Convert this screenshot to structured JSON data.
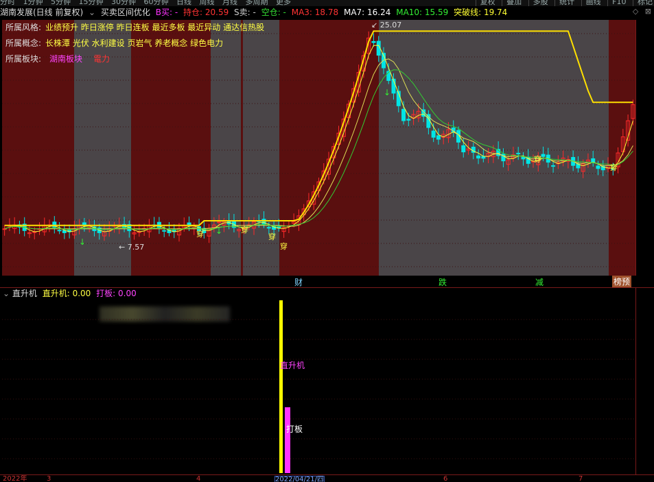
{
  "topbar": {
    "items": [
      "分时",
      "1分钟",
      "5分钟",
      "15分钟",
      "30分钟",
      "60分钟",
      "日线",
      "周线",
      "月线",
      "多周期",
      "更多"
    ],
    "right_items": [
      "复权",
      "叠加",
      "多股",
      "统计",
      "画线",
      "F10",
      "标记"
    ]
  },
  "title": {
    "stock": "湖南发展(日线 前复权)",
    "indicator": "买卖区间优化",
    "b_label": "B买: -",
    "hold_label": "持仓: 20.59",
    "s_label": "S卖: -",
    "empty_label": "空仓: -",
    "ma3": "MA3: 18.78",
    "ma7": "MA7: 16.24",
    "ma10": "MA10: 15.59",
    "breakout": "突破线: 19.74"
  },
  "info": {
    "style_label": "所属风格:",
    "style_value": "业绩预升 昨日涨停 昨日连板 最近多板 最近异动 通达信热股",
    "concept_label": "所属概念:",
    "concept_value": "长株潭 光伏 水利建设 页岩气 养老概念 绿色电力",
    "sector_label": "所属板块:",
    "sector_a": "湖南板块",
    "sector_b": "電力"
  },
  "annotations": {
    "high": "25.07",
    "low": "7.57",
    "cross": "穿",
    "cai": "财",
    "die": "跌",
    "jian": "减",
    "bang": "榜预"
  },
  "sub": {
    "name": "直升机",
    "val1": "直升机: 0.00",
    "val2": "打板: 0.00",
    "bar_label1": "直升机",
    "bar_label2": "打板"
  },
  "axis": {
    "dates": [
      "2022年",
      "3",
      "4",
      "2022/04/21/四",
      "6",
      "7"
    ]
  },
  "colors": {
    "up": "#ff2a2a",
    "down": "#00e5e5",
    "ma_yellow": "#ffff33",
    "ma_green": "#33cc33",
    "breakout": "#ffe000",
    "band_red": "#5a0f0f",
    "band_gray": "#4a4548",
    "magenta": "#ff33ff"
  }
}
